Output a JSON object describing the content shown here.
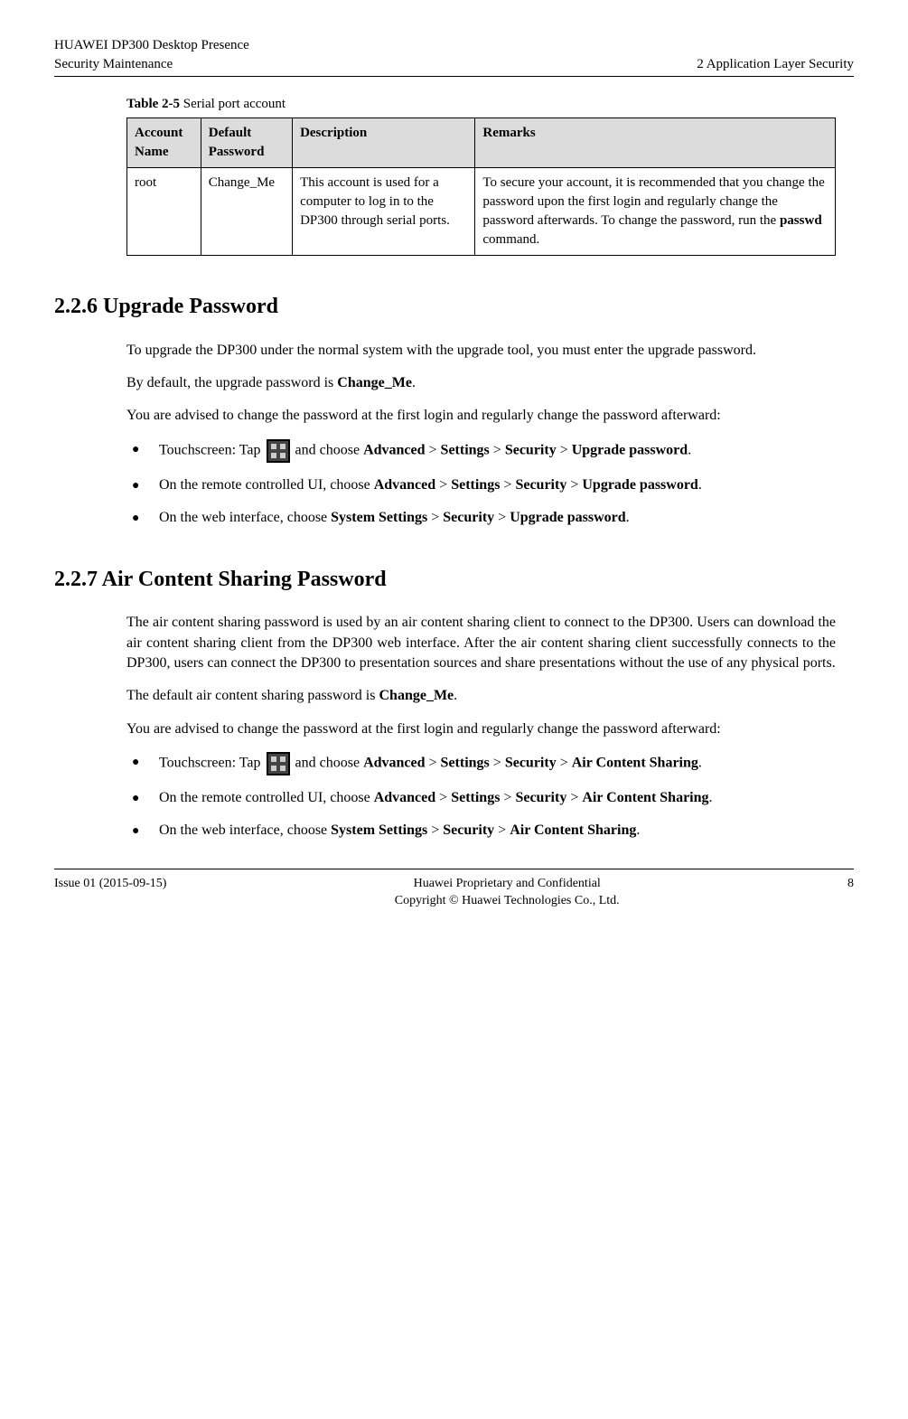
{
  "header": {
    "left_line1": "HUAWEI DP300 Desktop Presence",
    "left_line2": "Security Maintenance",
    "right": "2 Application Layer Security"
  },
  "table": {
    "caption_prefix": "Table 2-5",
    "caption_text": " Serial port account",
    "headers": [
      "Account Name",
      "Default Password",
      "Description",
      "Remarks"
    ],
    "row": {
      "account": "root",
      "password": "Change_Me",
      "description": "This account is used for a computer to log in to the DP300 through serial ports.",
      "remarks_pre": "To secure your account, it is recommended that you change the password upon the first login and regularly change the password afterwards. To change the password, run the ",
      "remarks_bold": "passwd",
      "remarks_post": " command."
    }
  },
  "section1": {
    "heading": "2.2.6 Upgrade Password",
    "p1": "To upgrade the DP300 under the normal system with the upgrade tool, you must enter the upgrade password.",
    "p2_pre": "By default, the upgrade password is ",
    "p2_bold": "Change_Me",
    "p2_post": ".",
    "p3": "You are advised to change the password at the first login and regularly change the password afterward:",
    "li1_pre": "Touchscreen: Tap ",
    "li1_mid": " and choose ",
    "li2_pre": "On the remote controlled UI, choose ",
    "li3_pre": "On the web interface, choose ",
    "path_advanced": "Advanced",
    "path_settings": "Settings",
    "path_security": "Security",
    "path_upgrade": "Upgrade password",
    "path_system": "System Settings",
    "gt": " > ",
    "dot": "."
  },
  "section2": {
    "heading": "2.2.7 Air Content Sharing Password",
    "p1": "The air content sharing password is used by an air content sharing client to connect to the DP300. Users can download the air content sharing client from the DP300 web interface. After the air content sharing client successfully connects to the DP300, users can connect the DP300 to presentation sources and share presentations without the use of any physical ports.",
    "p2_pre": "The default air content sharing password is ",
    "p2_bold": "Change_Me",
    "p2_post": ".",
    "p3": "You are advised to change the password at the first login and regularly change the password afterward:",
    "li1_pre": "Touchscreen: Tap ",
    "li1_mid": " and choose ",
    "li2_pre": "On the remote controlled UI, choose ",
    "li3_pre": "On the web interface, choose ",
    "path_air": "Air Content Sharing"
  },
  "footer": {
    "left": "Issue 01 (2015-09-15)",
    "center1": "Huawei Proprietary and Confidential",
    "center2": "Copyright © Huawei Technologies Co., Ltd.",
    "right": "8"
  }
}
